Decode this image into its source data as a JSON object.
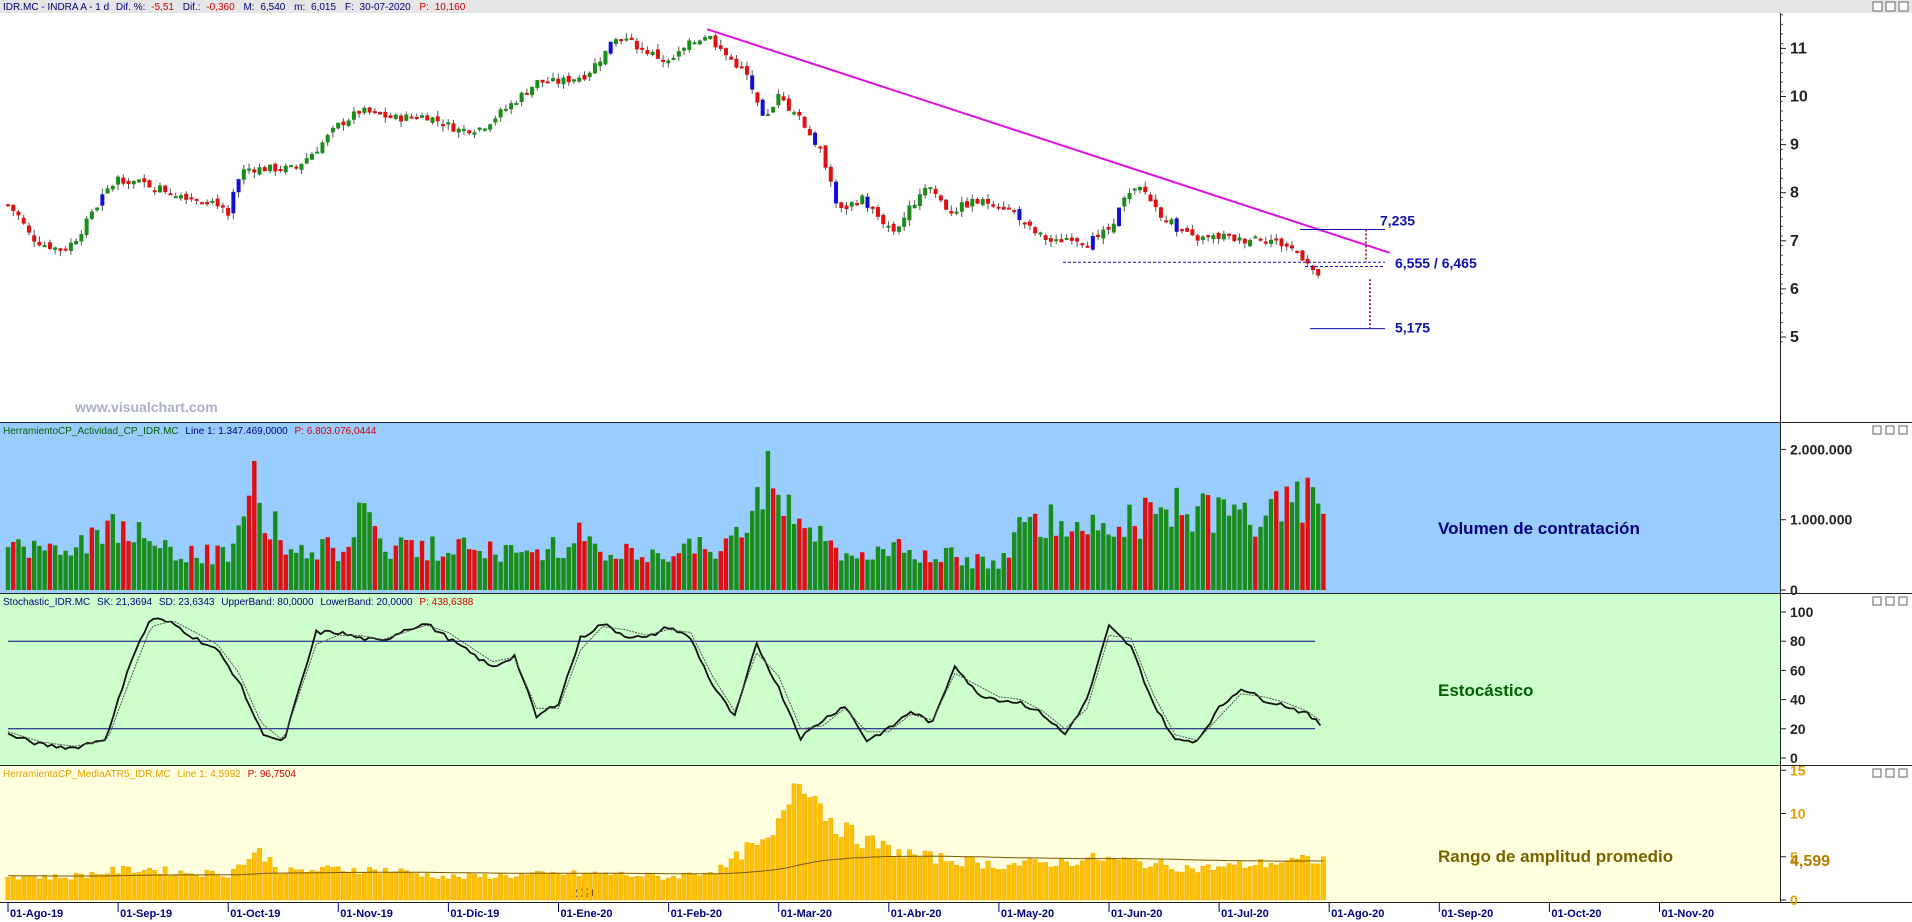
{
  "header": {
    "title": "IDR.MC - INDRA A - 1 d",
    "dif_pct_label": "Dif. %:",
    "dif_pct_value": "-5,51",
    "dif_label": "Dif.:",
    "dif_value": "-0,360",
    "max_label": "M:",
    "max_value": "6,540",
    "min_label": "m:",
    "min_value": "6,015",
    "date_label": "F:",
    "date_value": "30-07-2020",
    "price_label": "P:",
    "price_value": "10,160"
  },
  "watermark": "www.visualchart.com",
  "panels": {
    "volume": {
      "header_name": "HerramientoCP_Actividad_CP_IDR.MC",
      "header_line": "Line 1: 1.347.469,0000",
      "header_p": "P: 6.803.076,0444",
      "title": "Volumen de contratación"
    },
    "stochastic": {
      "header_name": "Stochastic_IDR.MC",
      "header_sk": "SK: 21,3694",
      "header_sd": "SD: 23,6343",
      "header_upper": "UpperBand: 80,0000",
      "header_lower": "LowerBand: 20,0000",
      "header_p": "P: 438,6388",
      "title": "Estocástico"
    },
    "atr": {
      "header_name": "HerramientaCP_MediaATR5_IDR.MC",
      "header_line": "Line 1: 4,5992",
      "header_p": "P: 96,7504",
      "title": "Rango de amplitud promedio",
      "year_label": "2020"
    }
  },
  "colors": {
    "up_candle": "#1a8c1a",
    "down_candle": "#e01010",
    "strong_candle": "#1010d0",
    "trendline": "#e010e0",
    "annotation": "#1010b0",
    "volume_bg": "#99ccff",
    "stochastic_bg": "#ccffcc",
    "atr_bg": "#ffffdd",
    "atr_bar": "#ffc000"
  },
  "chart_data": [
    {
      "type": "candlestick",
      "name": "IDR.MC - INDRA A",
      "ylim": [
        4.8,
        11.8
      ],
      "y_ticks": [
        "11",
        "10",
        "9",
        "8",
        "7",
        "6",
        "5"
      ],
      "x_dates": [
        "01-Ago-19",
        "01-Sep-19",
        "01-Oct-19",
        "01-Nov-19",
        "01-Dic-19",
        "01-Ene-20",
        "01-Feb-20",
        "01-Mar-20",
        "01-Abr-20",
        "01-May-20",
        "01-Jun-20",
        "01-Jul-20",
        "01-Ago-20",
        "01-Sep-20",
        "01-Oct-20",
        "01-Nov-20"
      ],
      "close_path": [
        [
          0,
          7.75
        ],
        [
          0.1,
          7.5
        ],
        [
          0.2,
          7.1
        ],
        [
          0.3,
          6.95
        ],
        [
          0.5,
          6.8
        ],
        [
          0.6,
          7.0
        ],
        [
          0.75,
          7.5
        ],
        [
          0.85,
          7.9
        ],
        [
          1.0,
          8.3
        ],
        [
          1.3,
          8.15
        ],
        [
          1.5,
          8.0
        ],
        [
          1.7,
          7.9
        ],
        [
          1.9,
          7.8
        ],
        [
          2.0,
          7.45
        ],
        [
          2.05,
          8.0
        ],
        [
          2.15,
          8.5
        ],
        [
          2.4,
          8.5
        ],
        [
          2.6,
          8.5
        ],
        [
          2.8,
          8.9
        ],
        [
          3.0,
          9.4
        ],
        [
          3.2,
          9.7
        ],
        [
          3.5,
          9.55
        ],
        [
          3.8,
          9.6
        ],
        [
          4.1,
          9.3
        ],
        [
          4.3,
          9.35
        ],
        [
          4.55,
          9.8
        ],
        [
          4.8,
          10.3
        ],
        [
          5.0,
          10.3
        ],
        [
          5.25,
          10.45
        ],
        [
          5.4,
          10.85
        ],
        [
          5.55,
          11.25
        ],
        [
          5.75,
          11.0
        ],
        [
          6.0,
          10.7
        ],
        [
          6.2,
          11.1
        ],
        [
          6.35,
          11.3
        ],
        [
          6.5,
          10.9
        ],
        [
          6.7,
          10.5
        ],
        [
          6.85,
          9.5
        ],
        [
          7.0,
          10.0
        ],
        [
          7.2,
          9.5
        ],
        [
          7.4,
          8.8
        ],
        [
          7.55,
          7.6
        ],
        [
          7.75,
          7.9
        ],
        [
          7.9,
          7.5
        ],
        [
          8.05,
          7.2
        ],
        [
          8.2,
          7.7
        ],
        [
          8.35,
          8.2
        ],
        [
          8.55,
          7.6
        ],
        [
          8.75,
          7.8
        ],
        [
          8.95,
          7.8
        ],
        [
          9.15,
          7.6
        ],
        [
          9.3,
          7.2
        ],
        [
          9.5,
          6.95
        ],
        [
          9.65,
          7.1
        ],
        [
          9.8,
          6.95
        ],
        [
          10.0,
          7.25
        ],
        [
          10.15,
          7.9
        ],
        [
          10.3,
          8.1
        ],
        [
          10.45,
          7.6
        ],
        [
          10.6,
          7.3
        ],
        [
          10.75,
          7.05
        ],
        [
          10.9,
          7.05
        ],
        [
          11.05,
          7.1
        ],
        [
          11.2,
          7.0
        ],
        [
          11.35,
          7.1
        ],
        [
          11.5,
          7.0
        ],
        [
          11.65,
          6.85
        ],
        [
          11.8,
          6.6
        ],
        [
          11.9,
          6.2
        ]
      ],
      "close_path_note": "x in months since 01-Ago-19 (0 = 01-Ago-19, 12 = 01-Ago-20)",
      "trendline": {
        "from": [
          6.35,
          11.4
        ],
        "to": [
          12.55,
          6.75
        ]
      },
      "levels": [
        {
          "label": "7,235",
          "value": 7.235
        },
        {
          "label": "6,555 / 6,465",
          "value": 6.555,
          "value2": 6.465
        },
        {
          "label": "5,175",
          "value": 5.175
        }
      ]
    },
    {
      "type": "bar",
      "name": "Volumen de contratación",
      "ylim": [
        0,
        2150000
      ],
      "y_ticks": [
        "2.000.000",
        "1.000.000",
        "0"
      ],
      "x_values": [
        0,
        0.5,
        1.0,
        1.3,
        1.5,
        2.0,
        2.2,
        2.5,
        3.0,
        3.2,
        3.5,
        4.0,
        4.2,
        4.5,
        5.0,
        5.2,
        5.5,
        6.0,
        6.5,
        6.7,
        6.9,
        7.1,
        7.3,
        7.5,
        7.7,
        8.0,
        8.3,
        8.5,
        8.8,
        9.0,
        9.3,
        9.5,
        9.8,
        10.0,
        10.3,
        10.5,
        10.8,
        11.0,
        11.2,
        11.4,
        11.6,
        11.8,
        11.95
      ],
      "values": [
        700000,
        550000,
        1000000,
        650000,
        550000,
        550000,
        1700000,
        650000,
        600000,
        1050000,
        600000,
        650000,
        700000,
        600000,
        650000,
        800000,
        550000,
        550000,
        650000,
        1100000,
        1600000,
        1400000,
        850000,
        600000,
        550000,
        650000,
        550000,
        500000,
        450000,
        400000,
        1200000,
        1050000,
        1000000,
        1150000,
        1050000,
        1200000,
        1200000,
        1100000,
        1100000,
        1200000,
        1300000,
        1450000,
        1350000
      ]
    },
    {
      "type": "line",
      "name": "Estocástico",
      "ylim": [
        0,
        100
      ],
      "y_ticks": [
        "100",
        "80",
        "60",
        "40",
        "20",
        "0"
      ],
      "upper_band": 80,
      "lower_band": 20,
      "series": [
        {
          "name": "SK",
          "x": [
            0,
            0.3,
            0.6,
            0.9,
            1.1,
            1.3,
            1.5,
            1.7,
            1.9,
            2.1,
            2.3,
            2.5,
            2.8,
            3.0,
            3.2,
            3.4,
            3.6,
            3.8,
            4.0,
            4.2,
            4.4,
            4.6,
            4.8,
            5.0,
            5.2,
            5.4,
            5.6,
            5.8,
            6.0,
            6.2,
            6.4,
            6.6,
            6.8,
            7.0,
            7.2,
            7.4,
            7.6,
            7.8,
            8.0,
            8.2,
            8.4,
            8.6,
            8.8,
            9.0,
            9.2,
            9.4,
            9.6,
            9.8,
            10.0,
            10.2,
            10.4,
            10.6,
            10.8,
            11.0,
            11.2,
            11.4,
            11.6,
            11.8,
            11.95
          ],
          "values": [
            16,
            9,
            7,
            14,
            64,
            96,
            92,
            82,
            74,
            52,
            18,
            10,
            86,
            86,
            82,
            80,
            88,
            92,
            82,
            72,
            62,
            70,
            28,
            38,
            82,
            92,
            84,
            82,
            90,
            82,
            50,
            28,
            78,
            48,
            14,
            26,
            36,
            12,
            20,
            32,
            24,
            64,
            44,
            40,
            38,
            30,
            16,
            40,
            90,
            76,
            38,
            12,
            12,
            34,
            48,
            40,
            36,
            30,
            21
          ]
        },
        {
          "name": "SD",
          "x": [
            0,
            0.3,
            0.6,
            0.9,
            1.1,
            1.3,
            1.5,
            1.7,
            1.9,
            2.1,
            2.3,
            2.5,
            2.8,
            3.0,
            3.2,
            3.4,
            3.6,
            3.8,
            4.0,
            4.2,
            4.4,
            4.6,
            4.8,
            5.0,
            5.2,
            5.4,
            5.6,
            5.8,
            6.0,
            6.2,
            6.4,
            6.6,
            6.8,
            7.0,
            7.2,
            7.4,
            7.6,
            7.8,
            8.0,
            8.2,
            8.4,
            8.6,
            8.8,
            9.0,
            9.2,
            9.4,
            9.6,
            9.8,
            10.0,
            10.2,
            10.4,
            10.6,
            10.8,
            11.0,
            11.2,
            11.4,
            11.6,
            11.8,
            11.95
          ],
          "values": [
            18,
            11,
            8,
            12,
            52,
            90,
            94,
            86,
            78,
            58,
            24,
            12,
            78,
            84,
            84,
            81,
            86,
            91,
            86,
            76,
            66,
            69,
            34,
            34,
            74,
            90,
            88,
            84,
            88,
            86,
            56,
            32,
            72,
            56,
            20,
            22,
            34,
            18,
            18,
            30,
            26,
            58,
            50,
            42,
            40,
            32,
            20,
            34,
            84,
            82,
            44,
            16,
            12,
            28,
            44,
            42,
            38,
            32,
            24
          ]
        }
      ]
    },
    {
      "type": "bar",
      "name": "Rango de amplitud promedio",
      "ylim": [
        0,
        15.5
      ],
      "y_ticks": [
        "15",
        "10",
        "5",
        "0"
      ],
      "last_value_label": "4,599",
      "x_values": [
        0,
        0.5,
        1.0,
        1.3,
        1.5,
        2.0,
        2.2,
        2.3,
        2.5,
        3.0,
        3.5,
        4.0,
        4.5,
        5.0,
        5.5,
        6.0,
        6.5,
        6.7,
        6.9,
        7.0,
        7.1,
        7.2,
        7.3,
        7.4,
        7.5,
        7.7,
        7.9,
        8.0,
        8.3,
        8.6,
        9.0,
        9.3,
        9.6,
        9.9,
        10.2,
        10.5,
        10.8,
        11.0,
        11.2,
        11.4,
        11.6,
        11.8,
        11.95
      ],
      "values": [
        2.8,
        2.6,
        3.4,
        3.6,
        3.2,
        3.0,
        5.0,
        5.5,
        3.2,
        3.6,
        3.4,
        2.6,
        2.8,
        3.0,
        3.0,
        2.6,
        3.6,
        5.8,
        6.5,
        8.5,
        12.5,
        14.8,
        13.0,
        10.5,
        9.0,
        7.2,
        6.4,
        5.8,
        5.0,
        4.6,
        4.0,
        4.2,
        4.4,
        4.8,
        4.4,
        4.0,
        3.6,
        3.8,
        4.0,
        4.2,
        4.4,
        4.6,
        4.599
      ]
    }
  ]
}
